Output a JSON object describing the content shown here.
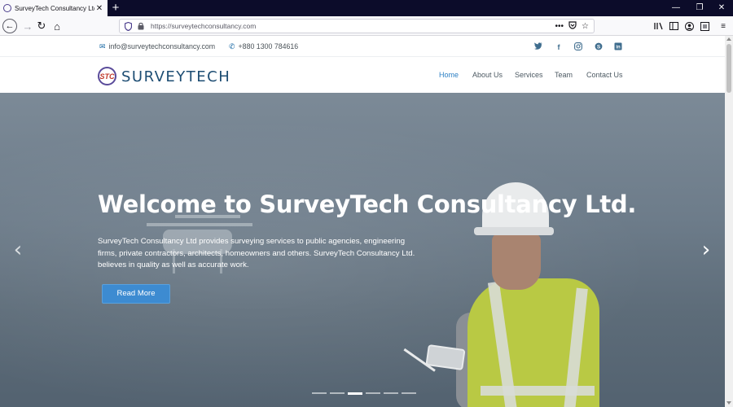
{
  "browser": {
    "tab_title": "SurveyTech Consultancy Ltd.",
    "url": "https://surveytechconsultancy.com",
    "icons": {
      "back": "back-arrow-icon",
      "forward": "forward-arrow-icon",
      "reload": "reload-icon",
      "home": "home-icon",
      "shield": "shield-icon",
      "lock": "lock-icon",
      "more": "more-actions-icon",
      "pocket": "pocket-icon",
      "bookmark": "star-icon"
    }
  },
  "topbar": {
    "email": "info@surveytechconsultancy.com",
    "phone": "+880 1300 784616",
    "social": [
      "twitter-icon",
      "facebook-icon",
      "instagram-icon",
      "skype-icon",
      "linkedin-icon"
    ]
  },
  "header": {
    "logo_text": "SURVEYTECH",
    "logo_mark": "STC",
    "menu": [
      "Home",
      "About Us",
      "Services",
      "Team",
      "Contact Us"
    ],
    "active_menu": "Home"
  },
  "hero": {
    "title": "Welcome to SurveyTech Consultancy Ltd.",
    "text": "SurveyTech Consultancy Ltd provides surveying services to public agencies, engineering firms, private contractors, architects, homeowners and others. SurveyTech Consultancy Ltd. believes in quality as well as accurate work.",
    "button": "Read More",
    "slides": 6,
    "active_slide": 3
  },
  "colors": {
    "accent": "#2b7fc4",
    "button": "#3d8bd1",
    "logo": "#1d4d73",
    "tabbar": "#0c0c2a"
  }
}
